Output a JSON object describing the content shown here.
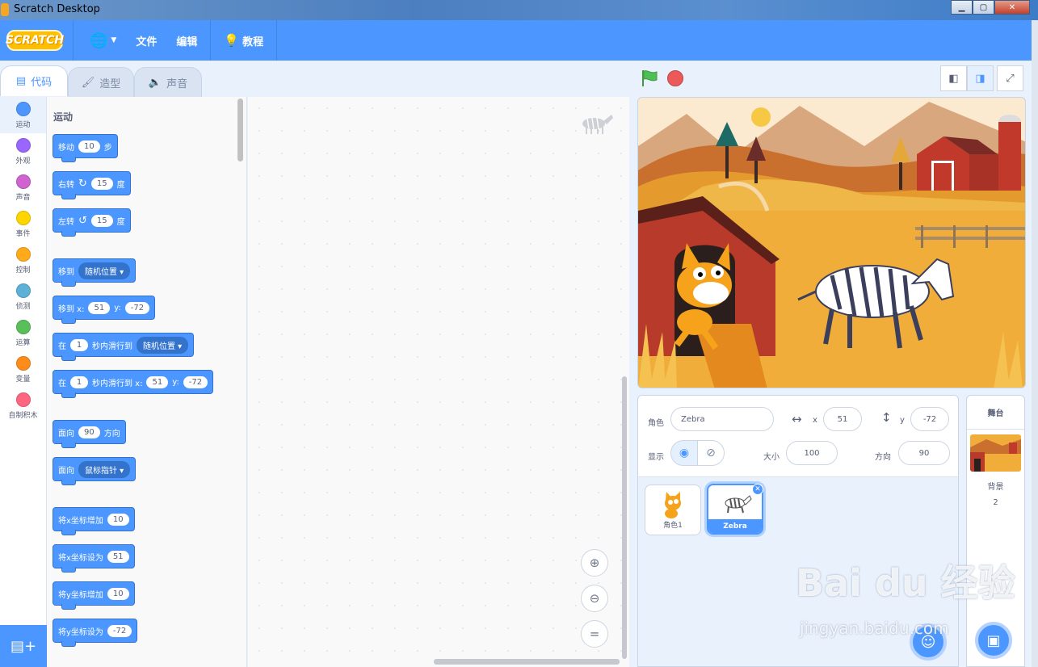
{
  "window": {
    "title": "Scratch Desktop"
  },
  "menu": {
    "logo": "SCRATCH",
    "file": "文件",
    "edit": "编辑",
    "tutorials": "教程"
  },
  "tabs": [
    {
      "label": "代码"
    },
    {
      "label": "造型"
    },
    {
      "label": "声音"
    }
  ],
  "categories": [
    {
      "label": "运动",
      "color": "#4c97ff"
    },
    {
      "label": "外观",
      "color": "#9966ff"
    },
    {
      "label": "声音",
      "color": "#cf63cf"
    },
    {
      "label": "事件",
      "color": "#ffd500"
    },
    {
      "label": "控制",
      "color": "#ffab19"
    },
    {
      "label": "侦测",
      "color": "#5cb1d6"
    },
    {
      "label": "运算",
      "color": "#59c059"
    },
    {
      "label": "变量",
      "color": "#ff8c1a"
    },
    {
      "label": "自制积木",
      "color": "#ff6680"
    }
  ],
  "palette": {
    "section_title": "运动",
    "move": {
      "a": "移动",
      "n": "10",
      "b": "步"
    },
    "turn_right": {
      "a": "右转",
      "n": "15",
      "b": "度"
    },
    "turn_left": {
      "a": "左转",
      "n": "15",
      "b": "度"
    },
    "goto": {
      "a": "移到",
      "dd": "随机位置"
    },
    "goto_xy": {
      "a": "移到 x:",
      "x": "51",
      "ylbl": "y:",
      "y": "-72"
    },
    "glide": {
      "a": "在",
      "n": "1",
      "b": "秒内滑行到",
      "dd": "随机位置"
    },
    "glide_xy": {
      "a": "在",
      "n": "1",
      "b": "秒内滑行到 x:",
      "x": "51",
      "ylbl": "y:",
      "y": "-72"
    },
    "point_dir": {
      "a": "面向",
      "n": "90",
      "b": "方向"
    },
    "point_towards": {
      "a": "面向",
      "dd": "鼠标指针"
    },
    "change_x": {
      "a": "将x坐标增加",
      "n": "10"
    },
    "set_x": {
      "a": "将x坐标设为",
      "n": "51"
    },
    "change_y": {
      "a": "将y坐标增加",
      "n": "10"
    },
    "set_y": {
      "a": "将y坐标设为",
      "n": "-72"
    }
  },
  "sprite_info": {
    "sprite_label": "角色",
    "sprite_name": "Zebra",
    "x_label": "x",
    "x": "51",
    "y_label": "y",
    "y": "-72",
    "show_label": "显示",
    "size_label": "大小",
    "size": "100",
    "direction_label": "方向",
    "direction": "90"
  },
  "sprites": [
    {
      "name": "角色1"
    },
    {
      "name": "Zebra"
    }
  ],
  "stage_pane": {
    "title": "舞台",
    "backdrops_label": "背景",
    "backdrops_count": "2"
  },
  "watermark": {
    "text": "Bai du 经验",
    "url": "jingyan.baidu.com"
  }
}
